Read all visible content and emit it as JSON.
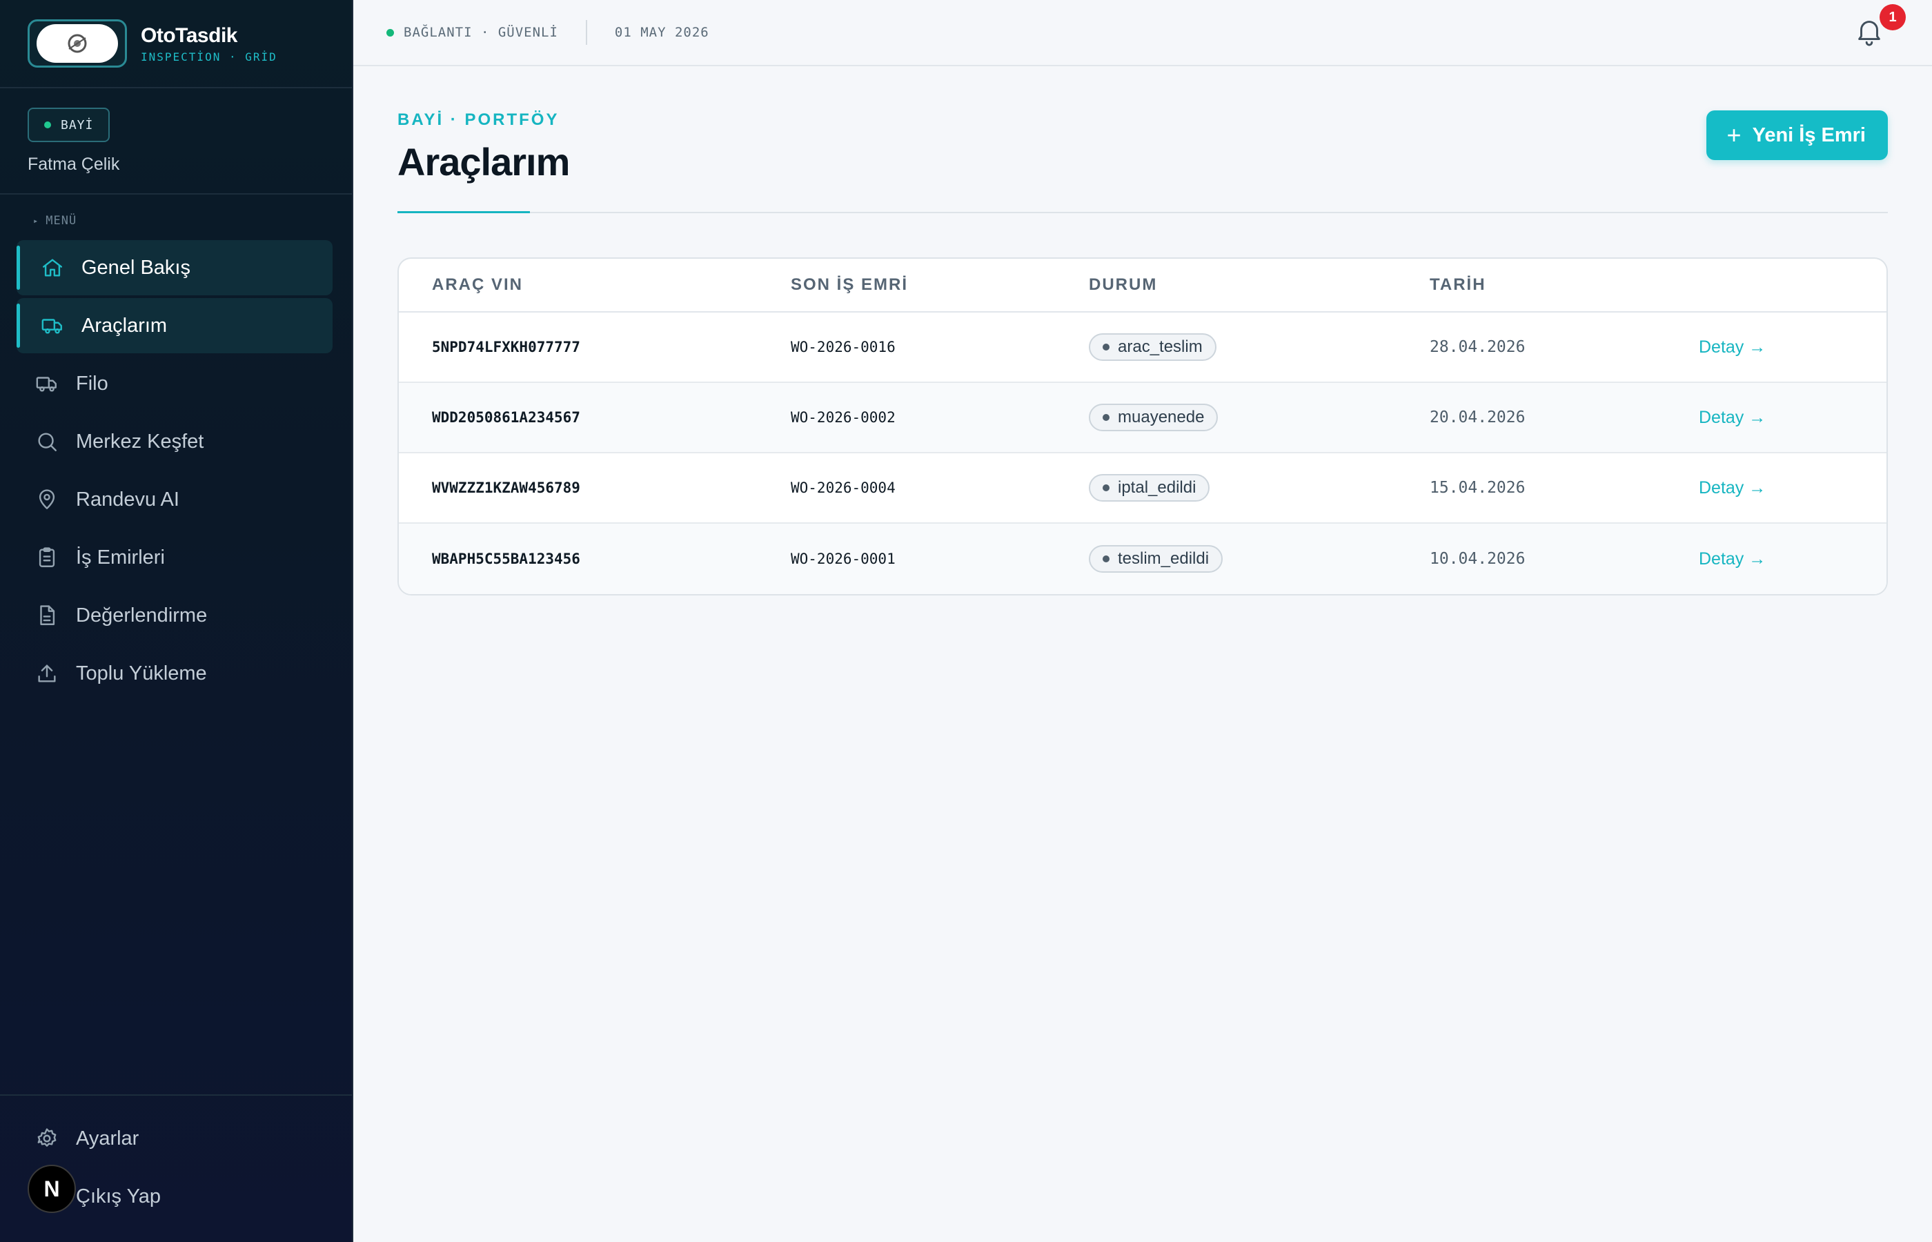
{
  "brand": {
    "name": "OtoTasdik",
    "subtitle": "INSPECTİON · GRİD"
  },
  "user": {
    "role": "BAYİ",
    "name": "Fatma Çelik"
  },
  "menu": {
    "label": "MENÜ",
    "items": [
      {
        "label": "Genel Bakış",
        "icon": "home-icon",
        "active": true
      },
      {
        "label": "Araçlarım",
        "icon": "truck-icon",
        "active": true
      },
      {
        "label": "Filo",
        "icon": "truck-icon",
        "active": false
      },
      {
        "label": "Merkez Keşfet",
        "icon": "search-icon",
        "active": false
      },
      {
        "label": "Randevu AI",
        "icon": "map-pin-icon",
        "active": false
      },
      {
        "label": "İş Emirleri",
        "icon": "clipboard-icon",
        "active": false
      },
      {
        "label": "Değerlendirme",
        "icon": "document-icon",
        "active": false
      },
      {
        "label": "Toplu Yükleme",
        "icon": "upload-icon",
        "active": false
      }
    ],
    "footer": [
      {
        "label": "Ayarlar",
        "icon": "gear-icon"
      },
      {
        "label": "Çıkış Yap",
        "icon": "logout-icon"
      }
    ]
  },
  "n_badge": "N",
  "topbar": {
    "connection": "BAĞLANTI · GÜVENLİ",
    "date": "01 MAY 2026",
    "notification_count": "1"
  },
  "page": {
    "eyebrow": "BAYİ · PORTFÖY",
    "title": "Araçlarım",
    "new_button_plus": "+",
    "new_button": "Yeni İş Emri"
  },
  "table": {
    "headers": [
      "ARAÇ VIN",
      "SON İŞ EMRİ",
      "DURUM",
      "TARİH"
    ],
    "rows": [
      {
        "vin": "5NPD74LFXKH077777",
        "wo": "WO-2026-0016",
        "status": "arac_teslim",
        "date": "28.04.2026",
        "action": "Detay →"
      },
      {
        "vin": "WDD2050861A234567",
        "wo": "WO-2026-0002",
        "status": "muayenede",
        "date": "20.04.2026",
        "action": "Detay →"
      },
      {
        "vin": "WVWZZZ1KZAW456789",
        "wo": "WO-2026-0004",
        "status": "iptal_edildi",
        "date": "15.04.2026",
        "action": "Detay →"
      },
      {
        "vin": "WBAPH5C55BA123456",
        "wo": "WO-2026-0001",
        "status": "teslim_edildi",
        "date": "10.04.2026",
        "action": "Detay →"
      }
    ]
  },
  "colors": {
    "accent": "#15bcc7",
    "sidebar": "#0a1c28",
    "notification": "#e5242f"
  }
}
